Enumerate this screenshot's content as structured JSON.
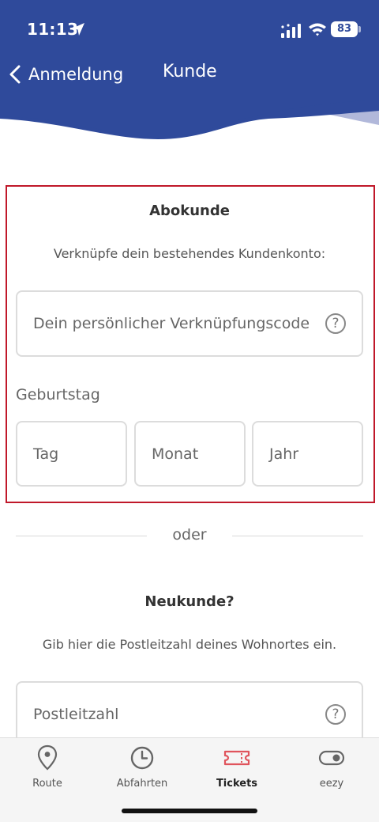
{
  "status_bar": {
    "time": "11:13",
    "battery": "83",
    "icons": [
      "location-arrow-icon",
      "signal-icon",
      "wifi-icon",
      "battery-icon"
    ]
  },
  "nav": {
    "back_label": "Anmeldung",
    "title": "Kunde"
  },
  "colors": {
    "header": "#2f4a9b",
    "card_border": "#c0182a",
    "active_tab_icon": "#e0545c"
  },
  "subscriber": {
    "title": "Abokunde",
    "subtitle": "Verknüpfe dein bestehendes Kundenkonto:",
    "code_placeholder": "Dein persönlicher Verknüpfungscode",
    "help_symbol": "?",
    "birthday_label": "Geburtstag",
    "day_placeholder": "Tag",
    "month_placeholder": "Monat",
    "year_placeholder": "Jahr"
  },
  "divider": {
    "text": "oder"
  },
  "new_customer": {
    "title": "Neukunde?",
    "subtitle": "Gib hier die Postleitzahl deines Wohnortes ein.",
    "zip_placeholder": "Postleitzahl",
    "help_symbol": "?"
  },
  "tabbar": {
    "items": [
      {
        "label": "Route",
        "icon": "map-pin-icon"
      },
      {
        "label": "Abfahrten",
        "icon": "clock-icon"
      },
      {
        "label": "Tickets",
        "icon": "ticket-icon",
        "active": true
      },
      {
        "label": "eezy",
        "icon": "toggle-icon"
      }
    ]
  }
}
